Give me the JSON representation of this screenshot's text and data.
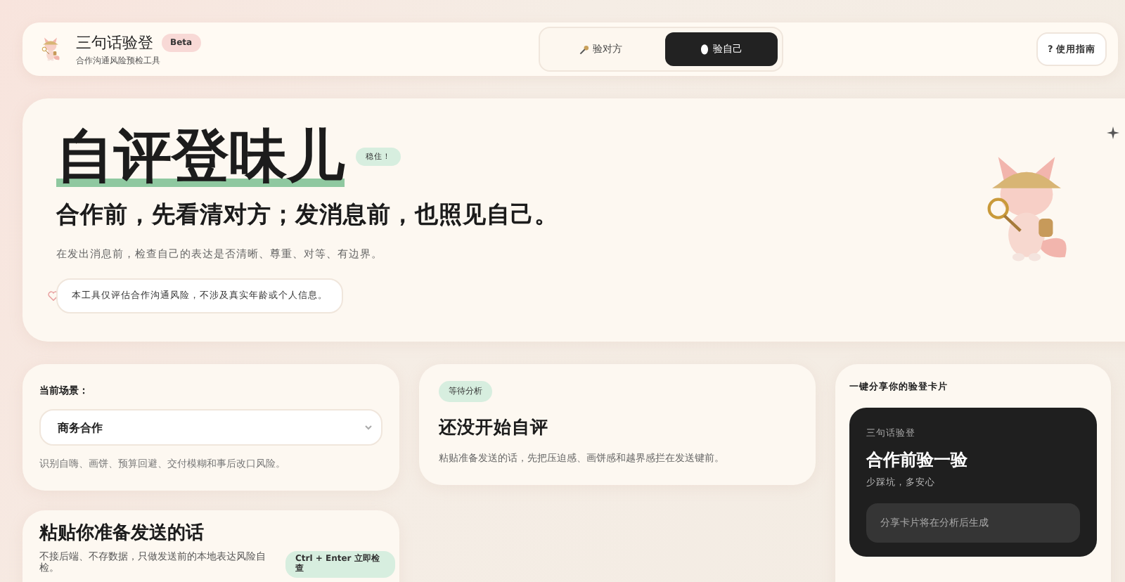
{
  "header": {
    "app_name": "三句话验登",
    "badge": "Beta",
    "subtitle": "合作沟通风险预检工具",
    "tabs": [
      {
        "kind": "magnifier",
        "label": "验对方",
        "selected": false
      },
      {
        "kind": "mirror",
        "label": "验自己",
        "selected": true
      }
    ],
    "help_button": "? 使用指南"
  },
  "hero": {
    "title": "自评登味儿",
    "tag": "稳住！",
    "headline": "合作前，先看清对方；发消息前，也照见自己。",
    "description": "在发出消息前，检查自己的表达是否清晰、尊重、对等、有边界。",
    "notice": "本工具仅评估合作沟通风险，不涉及真实年龄或个人信息。"
  },
  "scene": {
    "label": "当前场景：",
    "value": "商务合作",
    "hint": "识别自嗨、画饼、预算回避、交付模糊和事后改口风险。"
  },
  "paste": {
    "title": "粘贴你准备发送的话",
    "description": "不接后端、不存数据，只做发送前的本地表达风险自检。",
    "shortcut": "Ctrl + Enter 立即检查"
  },
  "result": {
    "status": "等待分析",
    "title": "还没开始自评",
    "description": "粘贴准备发送的话，先把压迫感、画饼感和越界感拦在发送键前。"
  },
  "share": {
    "label": "一键分享你的验登卡片",
    "card_brand": "三句话验登",
    "card_title": "合作前验一验",
    "card_subtitle": "少踩坑，多安心",
    "card_placeholder": "分享卡片将在分析后生成"
  }
}
